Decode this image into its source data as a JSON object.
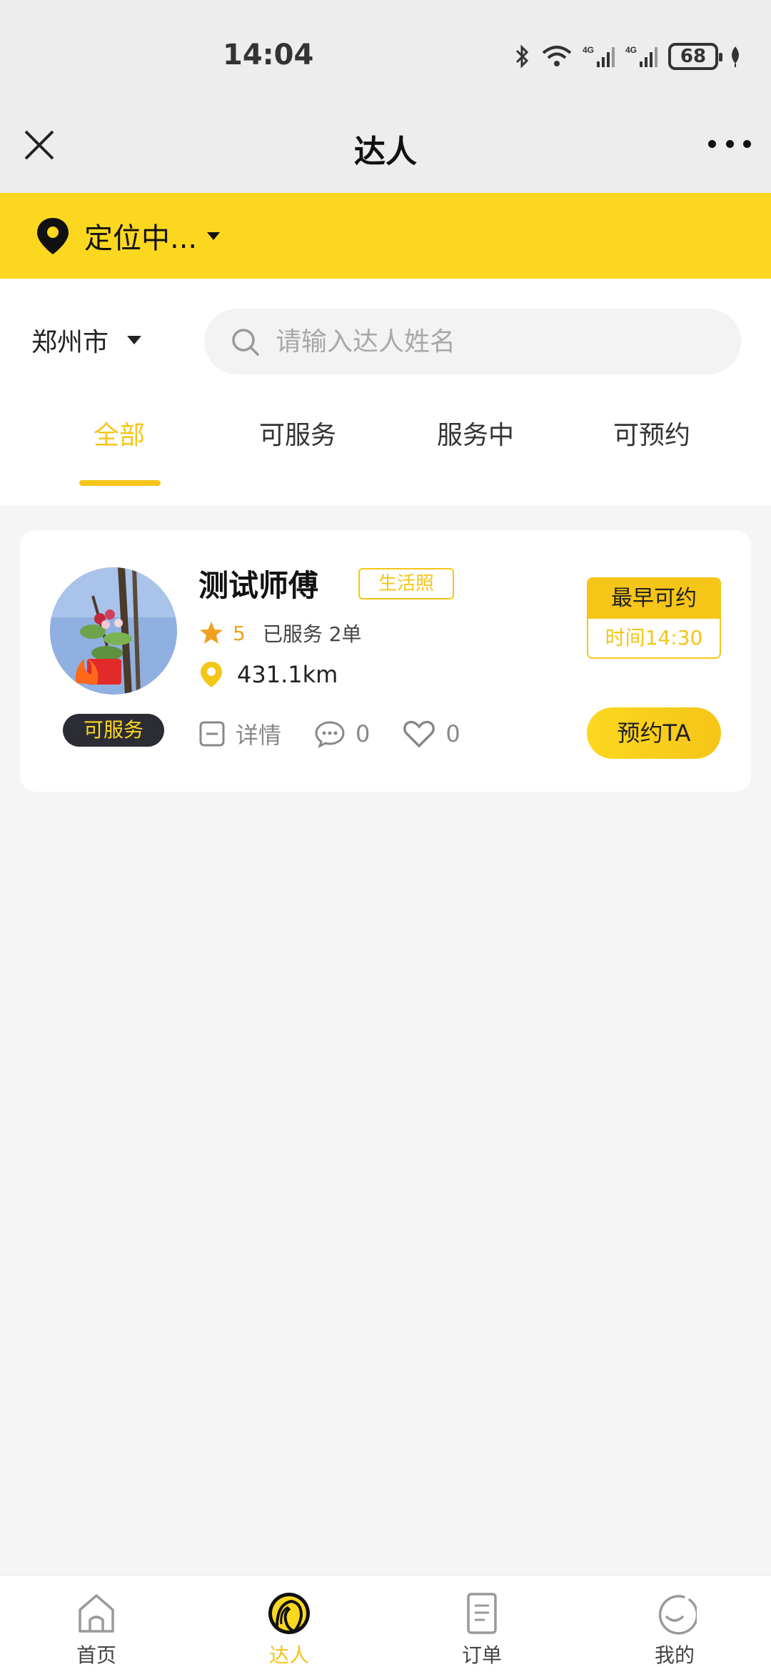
{
  "status_bar": {
    "time": "14:04",
    "battery": "68"
  },
  "nav": {
    "title": "达人"
  },
  "location": {
    "text": "定位中..."
  },
  "filter": {
    "city": "郑州市",
    "search_placeholder": "请输入达人姓名",
    "tabs": [
      {
        "label": "全部",
        "active": true
      },
      {
        "label": "可服务",
        "active": false
      },
      {
        "label": "服务中",
        "active": false
      },
      {
        "label": "可预约",
        "active": false
      }
    ]
  },
  "card": {
    "name": "测试师傅",
    "photo_tag": "生活照",
    "status": "可服务",
    "rating": "5",
    "served": "已服务 2单",
    "distance": "431.1km",
    "detail_label": "详情",
    "comments": "0",
    "likes": "0",
    "earliest_label": "最早可约",
    "earliest_time": "时间14:30",
    "book_label": "预约TA"
  },
  "tabbar": [
    {
      "label": "首页",
      "icon": "home-icon",
      "active": false
    },
    {
      "label": "达人",
      "icon": "expert-icon",
      "active": true
    },
    {
      "label": "订单",
      "icon": "order-icon",
      "active": false
    },
    {
      "label": "我的",
      "icon": "profile-icon",
      "active": false
    }
  ],
  "colors": {
    "accent": "#f5c518",
    "location_bar": "#fbd81f",
    "status_pill": "#2c2c34"
  }
}
